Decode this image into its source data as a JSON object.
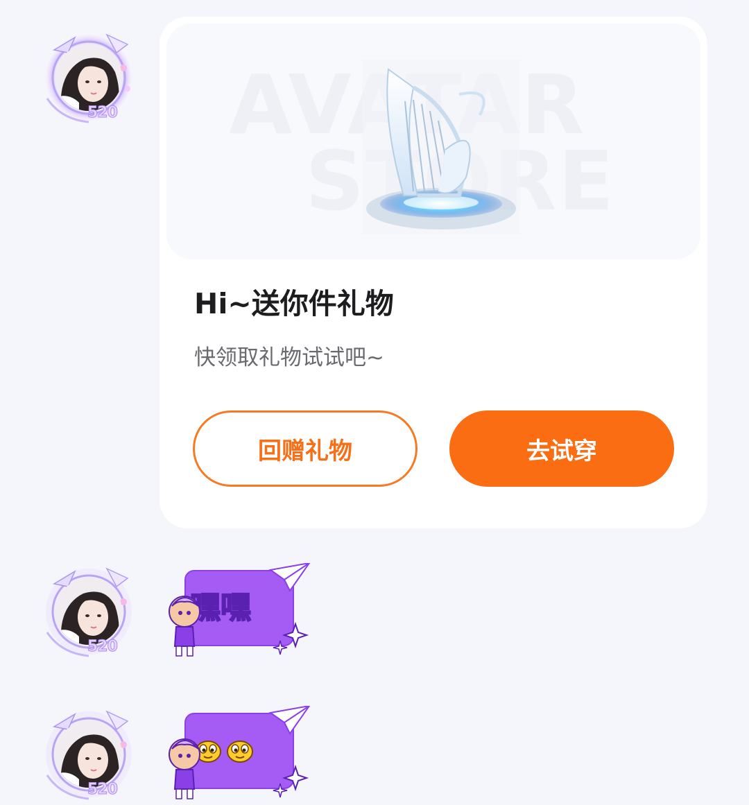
{
  "gift_card": {
    "banner_watermark": [
      "AVATAR",
      "STORE"
    ],
    "title": "Hi~送你件礼物",
    "subtitle": "快领取礼物试试吧~",
    "return_gift_label": "回赠礼物",
    "try_on_label": "去试穿"
  },
  "avatar": {
    "frame_badge": "520"
  },
  "messages": [
    {
      "type": "sticker",
      "text": "嘿嘿"
    },
    {
      "type": "sticker",
      "emoji": [
        "smiley-face-icon",
        "smiley-face-icon"
      ]
    }
  ],
  "colors": {
    "accent_orange": "#fa6d12",
    "sticker_purple": "#a45cf5",
    "background": "#f4f6fb"
  }
}
